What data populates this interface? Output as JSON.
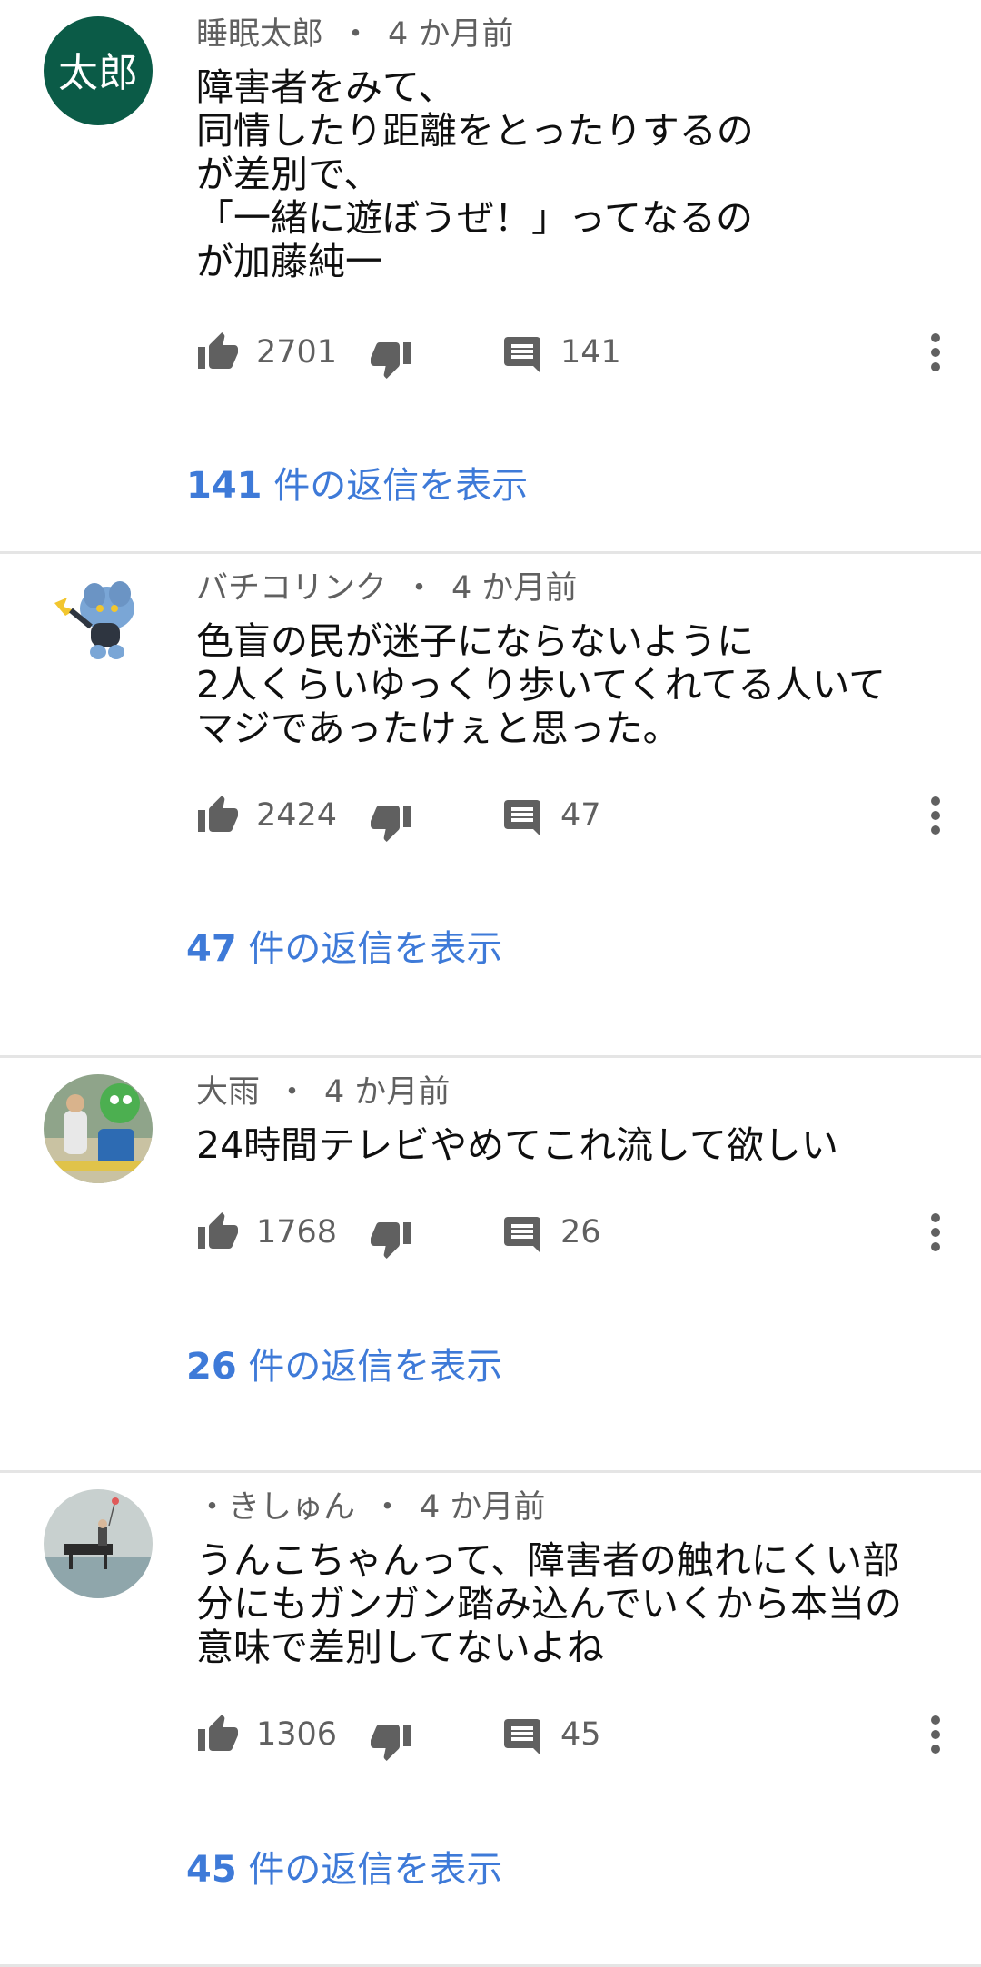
{
  "comments": [
    {
      "author": "睡眠太郎",
      "time": "4 か月前",
      "avatar_text": "太郎",
      "avatar_color": "#0b5b47",
      "lines": [
        "障害者をみて、",
        "同情したり距離をとったりするの",
        "が差別で、",
        "「一緒に遊ぼうぜ！」ってなるの",
        "が加藤純一"
      ],
      "likes": "2701",
      "replies_count": "141",
      "view_replies_num": "141",
      "view_replies_text": " 件の返信を表示"
    },
    {
      "author": "バチコリンク",
      "time": "4 か月前",
      "avatar_text": "",
      "avatar_color": "#ffffff",
      "lines": [
        "色盲の民が迷子にならないように",
        "2人くらいゆっくり歩いてくれてる人いて",
        "マジであったけぇと思った。"
      ],
      "likes": "2424",
      "replies_count": "47",
      "view_replies_num": "47",
      "view_replies_text": " 件の返信を表示"
    },
    {
      "author": "大雨",
      "time": "4 か月前",
      "avatar_text": "",
      "avatar_color": "#6f9c5a",
      "lines": [
        "24時間テレビやめてこれ流して欲しい"
      ],
      "likes": "1768",
      "replies_count": "26",
      "view_replies_num": "26",
      "view_replies_text": " 件の返信を表示"
    },
    {
      "author": "・きしゅん",
      "time": "4 か月前",
      "avatar_text": "",
      "avatar_color": "#b9c3c4",
      "lines": [
        "うんこちゃんって、障害者の触れにくい部",
        "分にもガンガン踏み込んでいくから本当の",
        "意味で差別してないよね"
      ],
      "likes": "1306",
      "replies_count": "45",
      "view_replies_num": "45",
      "view_replies_text": " 件の返信を表示"
    }
  ],
  "separator": "・",
  "icons": {
    "like": "thumb-up-icon",
    "dislike": "thumb-down-icon",
    "reply": "comment-icon",
    "more": "more-vert-icon"
  },
  "colors": {
    "link": "#3e7ad8",
    "secondary_text": "#606060",
    "icon": "#606060"
  }
}
